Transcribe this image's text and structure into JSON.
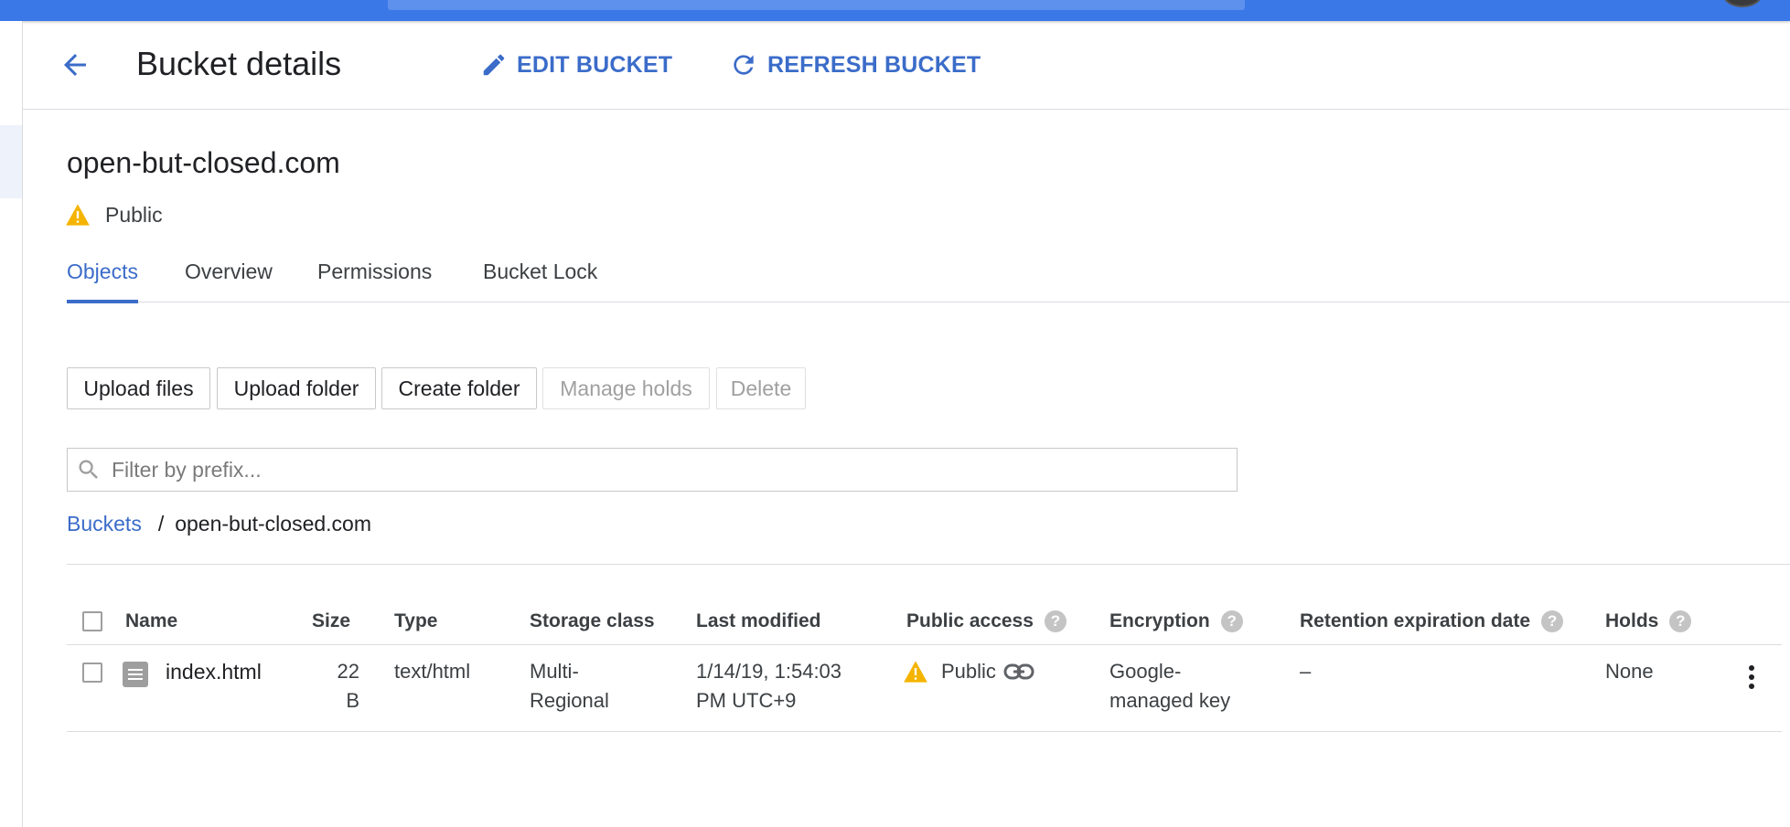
{
  "header": {
    "title": "Bucket details",
    "edit_label": "EDIT BUCKET",
    "refresh_label": "REFRESH BUCKET"
  },
  "bucket": {
    "name": "open-but-closed.com",
    "access": "Public"
  },
  "tabs": [
    {
      "label": "Objects",
      "active": true
    },
    {
      "label": "Overview",
      "active": false
    },
    {
      "label": "Permissions",
      "active": false
    },
    {
      "label": "Bucket Lock",
      "active": false
    }
  ],
  "toolbar": {
    "upload_files": "Upload files",
    "upload_folder": "Upload folder",
    "create_folder": "Create folder",
    "manage_holds": "Manage holds",
    "delete": "Delete"
  },
  "filter": {
    "placeholder": "Filter by prefix..."
  },
  "breadcrumb": {
    "root": "Buckets",
    "separator": "/",
    "current": "open-but-closed.com"
  },
  "table": {
    "columns": {
      "name": "Name",
      "size": "Size",
      "type": "Type",
      "storage_class": "Storage class",
      "last_modified": "Last modified",
      "public_access": "Public access",
      "encryption": "Encryption",
      "retention": "Retention expiration date",
      "holds": "Holds"
    },
    "help_glyph": "?",
    "rows": [
      {
        "name": "index.html",
        "size_line1": "22",
        "size_line2": "B",
        "type": "text/html",
        "storage_line1": "Multi-",
        "storage_line2": "Regional",
        "modified_line1": "1/14/19, 1:54:03",
        "modified_line2": "PM UTC+9",
        "public_access": "Public",
        "encryption_line1": "Google-",
        "encryption_line2": "managed key",
        "retention": "–",
        "holds": "None"
      }
    ]
  },
  "colors": {
    "accent": "#3b6cc9",
    "topbar": "#3b78e7",
    "warning": "#f4b400"
  },
  "icons": {
    "back": "arrow-back-icon",
    "edit": "pencil-icon",
    "refresh": "refresh-icon",
    "warning": "warning-icon",
    "search": "search-icon",
    "link": "link-icon",
    "file": "file-icon",
    "more": "more-vert-icon"
  }
}
